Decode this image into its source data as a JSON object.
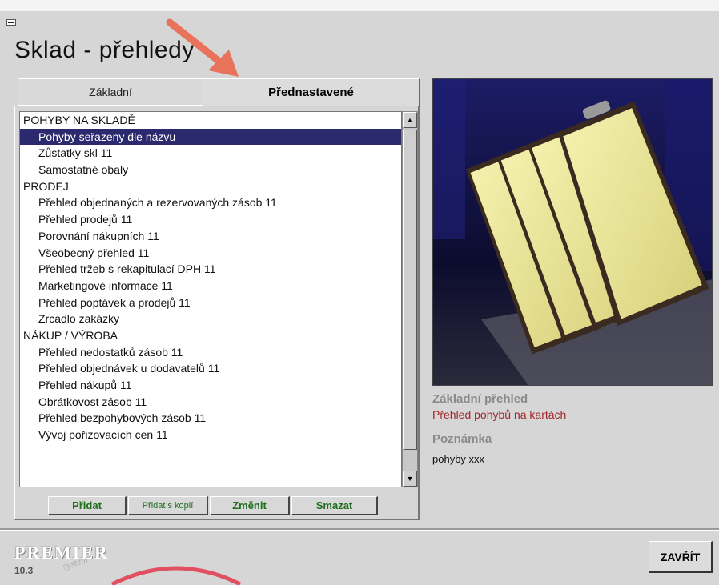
{
  "window": {
    "title": "Sklad - přehledy"
  },
  "tabs": [
    {
      "label": "Základní",
      "active": false
    },
    {
      "label": "Přednastavené",
      "active": true
    }
  ],
  "list": {
    "rows": [
      {
        "label": "POHYBY NA SKLADĚ",
        "type": "group"
      },
      {
        "label": "Pohyby seřazeny dle názvu",
        "type": "item",
        "selected": true
      },
      {
        "label": "Zůstatky skl 11",
        "type": "item"
      },
      {
        "label": "Samostatné obaly",
        "type": "item"
      },
      {
        "label": "PRODEJ",
        "type": "group"
      },
      {
        "label": "Přehled objednaných a rezervovaných zásob 11",
        "type": "item"
      },
      {
        "label": "Přehled prodejů 11",
        "type": "item"
      },
      {
        "label": "Porovnání nákupních 11",
        "type": "item"
      },
      {
        "label": "Všeobecný přehled 11",
        "type": "item"
      },
      {
        "label": "Přehled tržeb s rekapitulací DPH 11",
        "type": "item"
      },
      {
        "label": "Marketingové informace 11",
        "type": "item"
      },
      {
        "label": "Přehled poptávek a prodejů 11",
        "type": "item"
      },
      {
        "label": "Zrcadlo zakázky",
        "type": "item"
      },
      {
        "label": "NÁKUP /  VÝROBA",
        "type": "group"
      },
      {
        "label": "Přehled nedostatků zásob 11",
        "type": "item"
      },
      {
        "label": "Přehled objednávek u dodavatelů 11",
        "type": "item"
      },
      {
        "label": "Přehled nákupů 11",
        "type": "item"
      },
      {
        "label": "Obrátkovost zásob 11",
        "type": "item"
      },
      {
        "label": "Přehled bezpohybových zásob 11",
        "type": "item"
      },
      {
        "label": "Vývoj pořizovacích cen  11",
        "type": "item"
      }
    ]
  },
  "buttons": {
    "add": "Přidat",
    "add_copy": "Přidat s kopií",
    "edit": "Změnit",
    "delete": "Smazat"
  },
  "details": {
    "title_label": "Základní přehled",
    "title_value": "Přehled pohybů na kartách",
    "note_label": "Poznámka",
    "note_value": "pohyby xxx"
  },
  "footer": {
    "logo_text": "PREMIER",
    "logo_signature": "system",
    "version": "10.3",
    "close_label": "ZAVŘÍT"
  },
  "colors": {
    "selection": "#2c2a6e",
    "button_text": "#1e6e1e",
    "detail_value": "#a0282a",
    "arrow": "#e8735a"
  }
}
